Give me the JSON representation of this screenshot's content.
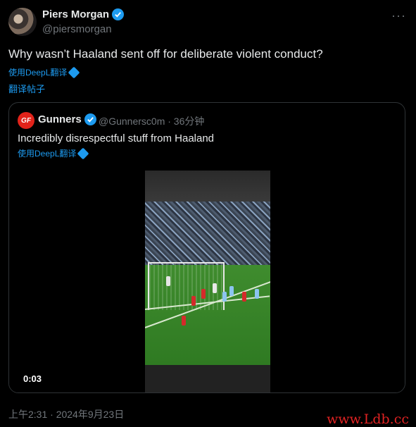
{
  "author": {
    "name": "Piers Morgan",
    "handle": "@piersmorgan"
  },
  "more_label": "···",
  "tweet": {
    "text": "Why wasn’t Haaland sent off for deliberate violent conduct?"
  },
  "translate_deepl": "使用DeepL翻译",
  "translate_post": "翻译帖子",
  "quote": {
    "author_name": "Gunners",
    "meta": "@Gunnersc0m · 36分钟",
    "text": "Incredibly disrespectful stuff from Haaland",
    "translate_deepl": "使用DeepL翻译",
    "avatar_text": "GF",
    "video_time": "0:03"
  },
  "timestamp": "上午2:31 · 2024年9月23日",
  "watermark": "www.Ldb.cc",
  "colors": {
    "accent": "#1d9bf0",
    "muted": "#71767b",
    "text": "#e7e9ea",
    "border": "#2f3336"
  }
}
